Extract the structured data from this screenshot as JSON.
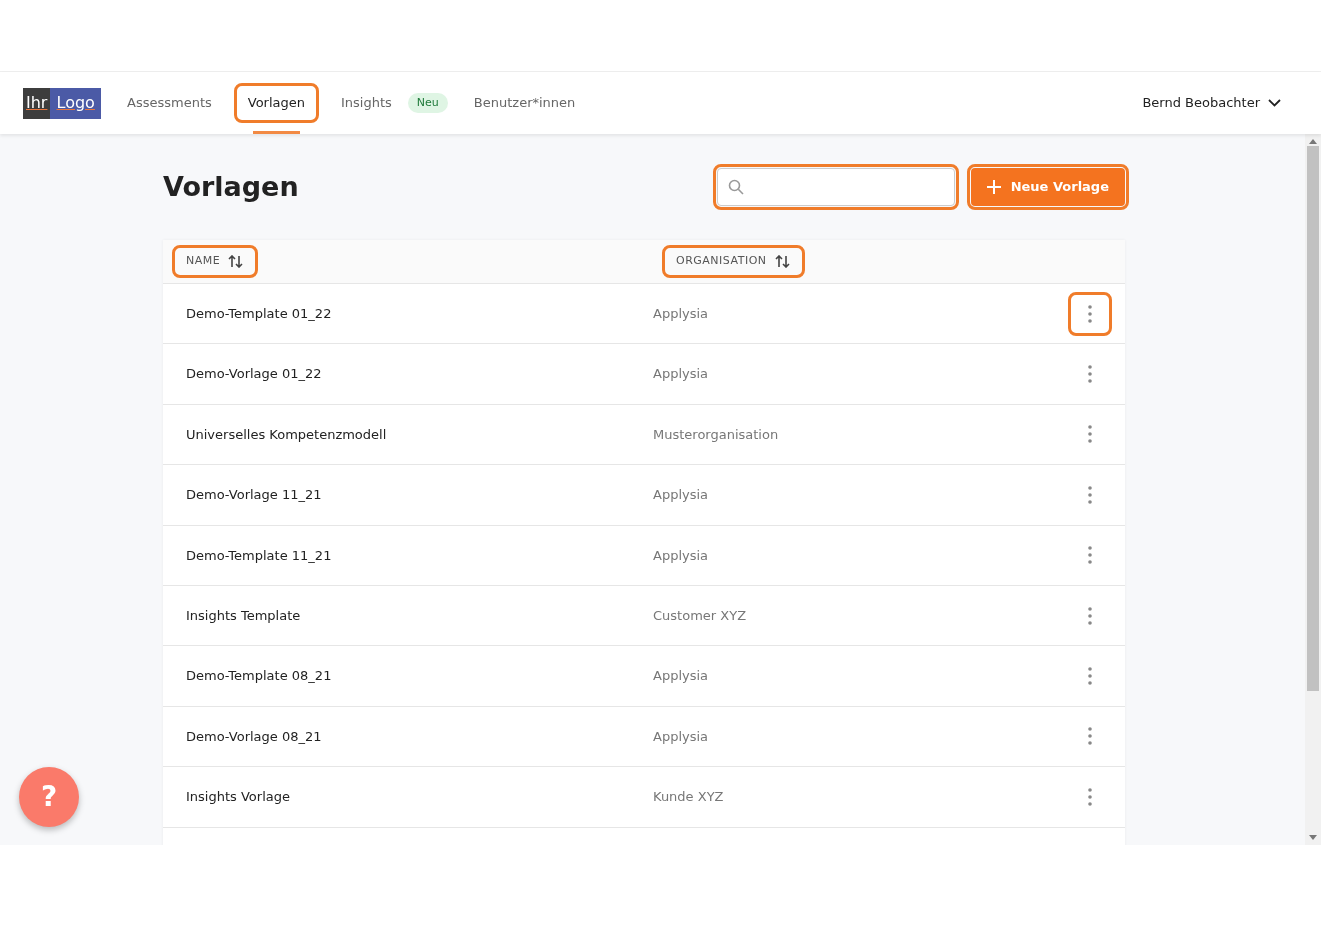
{
  "logo": {
    "text_left": "Ihr",
    "text_right": "Logo"
  },
  "nav": {
    "tabs": [
      {
        "label": "Assessments",
        "selected": false,
        "highlighted": false
      },
      {
        "label": "Vorlagen",
        "selected": true,
        "highlighted": true
      },
      {
        "label": "Insights",
        "selected": false,
        "highlighted": false,
        "badge": "Neu"
      },
      {
        "label": "Benutzer*innen",
        "selected": false,
        "highlighted": false
      }
    ],
    "user": "Bernd Beobachter"
  },
  "page": {
    "title": "Vorlagen",
    "search": {
      "highlighted": true
    },
    "new_button": {
      "label": "Neue Vorlage",
      "highlighted": true
    }
  },
  "table": {
    "columns": [
      {
        "label": "NAME",
        "highlighted": true
      },
      {
        "label": "ORGANISATION",
        "highlighted": true
      }
    ],
    "rows": [
      {
        "name": "Demo-Template 01_22",
        "organisation": "Applysia",
        "menu_highlighted": true
      },
      {
        "name": "Demo-Vorlage 01_22",
        "organisation": "Applysia",
        "menu_highlighted": false
      },
      {
        "name": "Universelles Kompetenzmodell",
        "organisation": "Musterorganisation",
        "menu_highlighted": false
      },
      {
        "name": "Demo-Vorlage 11_21",
        "organisation": "Applysia",
        "menu_highlighted": false
      },
      {
        "name": "Demo-Template 11_21",
        "organisation": "Applysia",
        "menu_highlighted": false
      },
      {
        "name": "Insights Template",
        "organisation": "Customer XYZ",
        "menu_highlighted": false
      },
      {
        "name": "Demo-Template 08_21",
        "organisation": "Applysia",
        "menu_highlighted": false
      },
      {
        "name": "Demo-Vorlage 08_21",
        "organisation": "Applysia",
        "menu_highlighted": false
      },
      {
        "name": "Insights Vorlage",
        "organisation": "Kunde XYZ",
        "menu_highlighted": false
      }
    ]
  },
  "help_button": {
    "label": "?"
  }
}
